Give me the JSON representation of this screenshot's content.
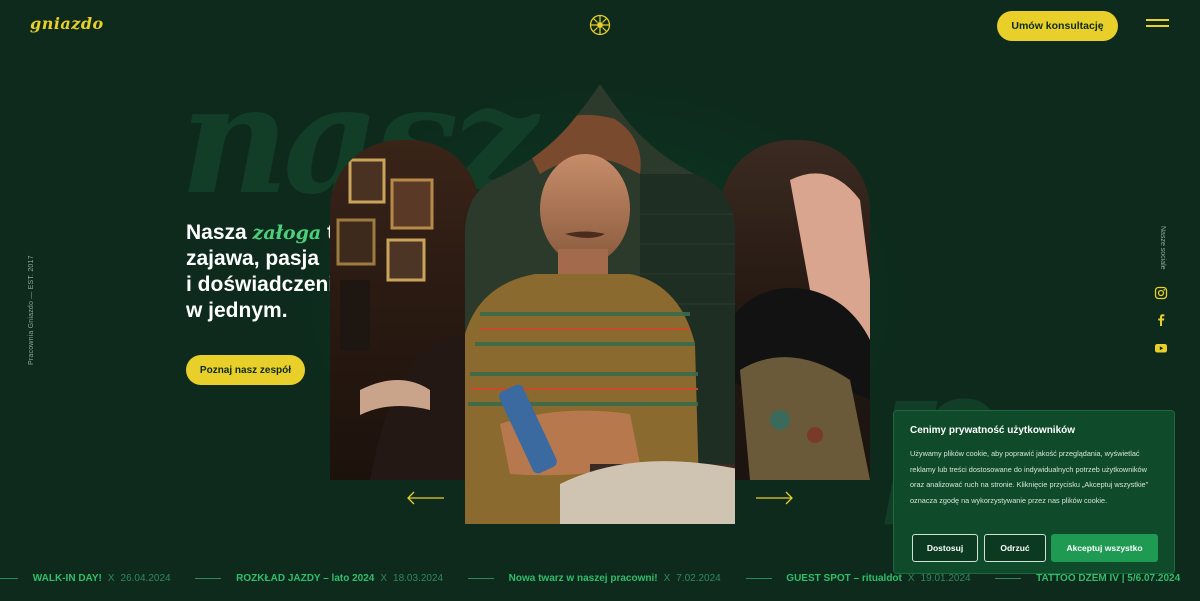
{
  "header": {
    "logo": "gniazdo",
    "cta_label": "Umów konsultację"
  },
  "background_text": "nasz",
  "side": {
    "left_text": "Pracownia Gniazdo — EST. 2017",
    "right_text": "Nasze sociale"
  },
  "social": [
    "instagram-icon",
    "facebook-icon",
    "youtube-icon"
  ],
  "hero": {
    "line1_pre": "Nasza ",
    "line1_accent": "załoga",
    "line1_post": " to",
    "line2": "zajawa, pasja",
    "line3": "i doświadczenie",
    "line4": "w jednym.",
    "button_label": "Poznaj nasz zespół"
  },
  "ticker": [
    {
      "title": "WALK-IN DAY!",
      "date": "26.04.2024"
    },
    {
      "title": "ROZKŁAD JAZDY – lato 2024",
      "date": "18.03.2024"
    },
    {
      "title": "Nowa twarz w naszej pracowni!",
      "date": "7.02.2024"
    },
    {
      "title": "GUEST SPOT – ritualdot",
      "date": "19.01.2024"
    },
    {
      "title": "TATTOO DŻEM IV | 5/6.07.2024",
      "date": ""
    }
  ],
  "ticker_separator": "X",
  "cookie": {
    "title": "Cenimy prywatność użytkowników",
    "text": "Używamy plików cookie, aby poprawić jakość przeglądania, wyświetlać reklamy lub treści dostosowane do indywidualnych potrzeb użytkowników oraz analizować ruch na stronie. Kliknięcie przycisku „Akceptuj wszystkie” oznacza zgodę na wykorzystywanie przez nas plików cookie.",
    "customize_label": "Dostosuj",
    "reject_label": "Odrzuć",
    "accept_label": "Akceptuj wszystko"
  },
  "colors": {
    "background": "#0d2a1c",
    "accent_yellow": "#e8cf2a",
    "accent_green": "#4dcf7a",
    "cookie_bg": "#0f4a2a"
  }
}
